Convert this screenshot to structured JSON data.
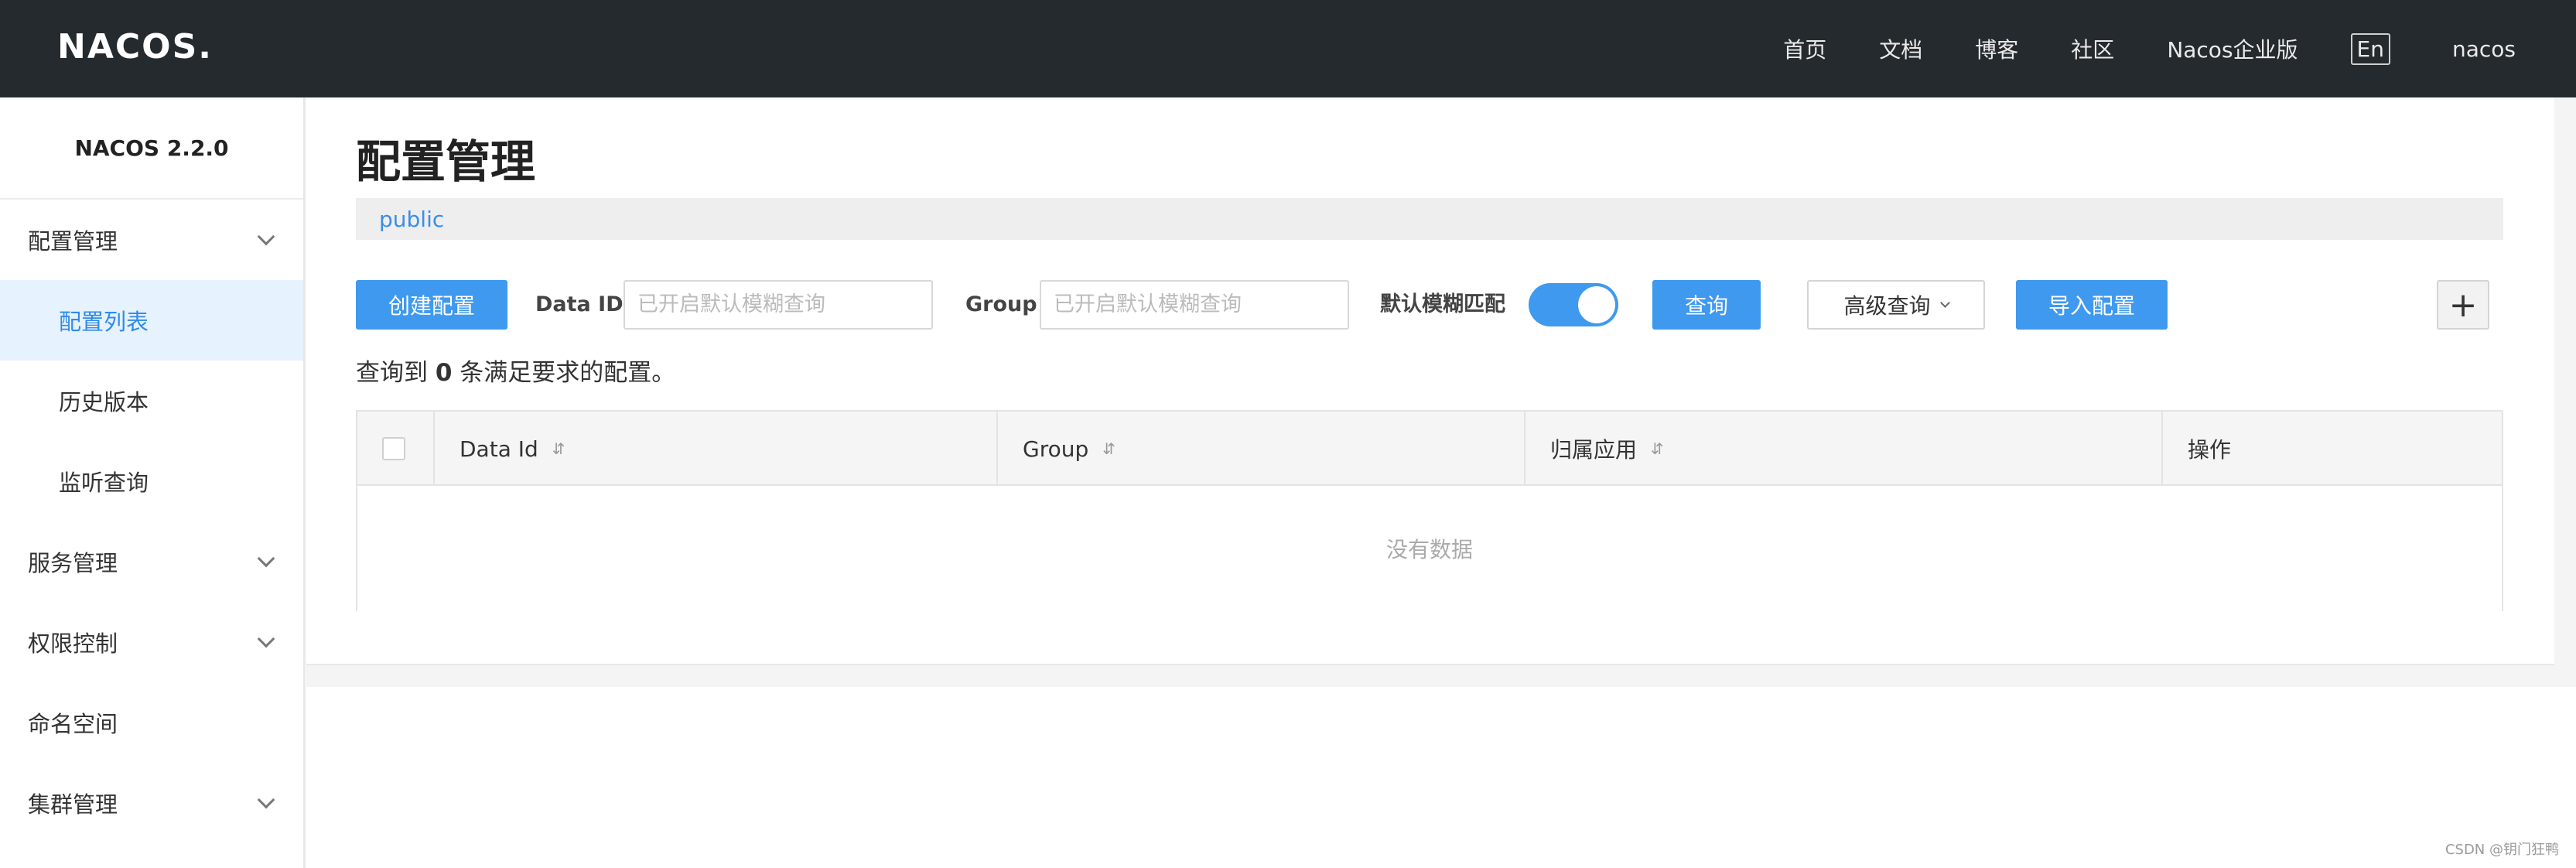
{
  "header": {
    "logo": "NACOS.",
    "nav": [
      "首页",
      "文档",
      "博客",
      "社区",
      "Nacos企业版"
    ],
    "lang": "En",
    "user": "nacos"
  },
  "sidebar": {
    "version": "NACOS 2.2.0",
    "items": [
      {
        "label": "配置管理",
        "expandable": true
      },
      {
        "label": "配置列表",
        "sub": true,
        "active": true
      },
      {
        "label": "历史版本",
        "sub": true
      },
      {
        "label": "监听查询",
        "sub": true
      },
      {
        "label": "服务管理",
        "expandable": true
      },
      {
        "label": "权限控制",
        "expandable": true
      },
      {
        "label": "命名空间"
      },
      {
        "label": "集群管理",
        "expandable": true
      }
    ]
  },
  "main": {
    "title": "配置管理",
    "namespace": "public",
    "toolbar": {
      "create_label": "创建配置",
      "dataid_label": "Data ID",
      "dataid_placeholder": "已开启默认模糊查询",
      "group_label": "Group",
      "group_placeholder": "已开启默认模糊查询",
      "fuzzy_label": "默认模糊匹配",
      "fuzzy_on": true,
      "search_label": "查询",
      "advanced_label": "高级查询",
      "import_label": "导入配置",
      "plus": "+"
    },
    "result": {
      "prefix": "查询到",
      "count": "0",
      "suffix": "条满足要求的配置。"
    },
    "table": {
      "columns": [
        "Data Id",
        "Group",
        "归属应用",
        "操作"
      ],
      "sort_glyph": "⇵",
      "empty": "没有数据"
    }
  },
  "watermark": "CSDN @钥门狂鸭",
  "colors": {
    "primary": "#3f99ee",
    "header_bg": "#252a2f",
    "active_bg": "#e6f2fd"
  }
}
